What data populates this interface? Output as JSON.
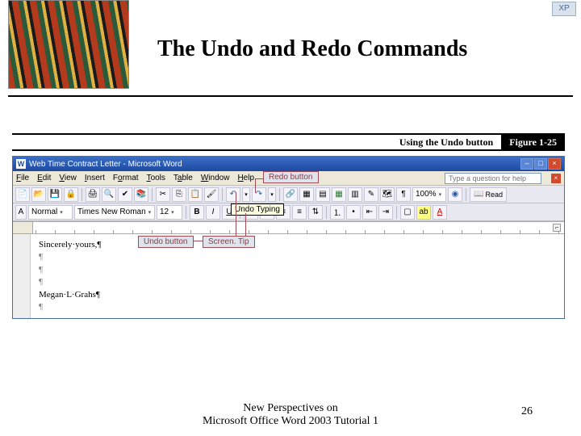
{
  "slide": {
    "title": "The Undo and Redo Commands",
    "xp_badge": "XP"
  },
  "figure": {
    "caption": "Using the Undo button",
    "number": "Figure 1-25"
  },
  "word": {
    "title": "Web Time Contract Letter - Microsoft Word",
    "menu": {
      "file": "File",
      "edit": "Edit",
      "view": "View",
      "insert": "Insert",
      "format": "Format",
      "tools": "Tools",
      "table": "Table",
      "window": "Window",
      "help": "Help"
    },
    "help_placeholder": "Type a question for help",
    "toolbar2": {
      "style": "Normal",
      "font": "Times New Roman",
      "size": "12"
    },
    "zoom": "100%",
    "read_label": "Read",
    "tooltip": "Undo Typing",
    "doc": {
      "line1": "Sincerely·yours,¶",
      "blank": "¶",
      "line2": "Megan·L·Grahs¶"
    }
  },
  "callouts": {
    "redo": "Redo button",
    "undo": "Undo button",
    "screentip": "Screen. Tip"
  },
  "footer": {
    "line1": "New Perspectives on",
    "line2": "Microsoft Office Word 2003 Tutorial 1",
    "page": "26"
  }
}
